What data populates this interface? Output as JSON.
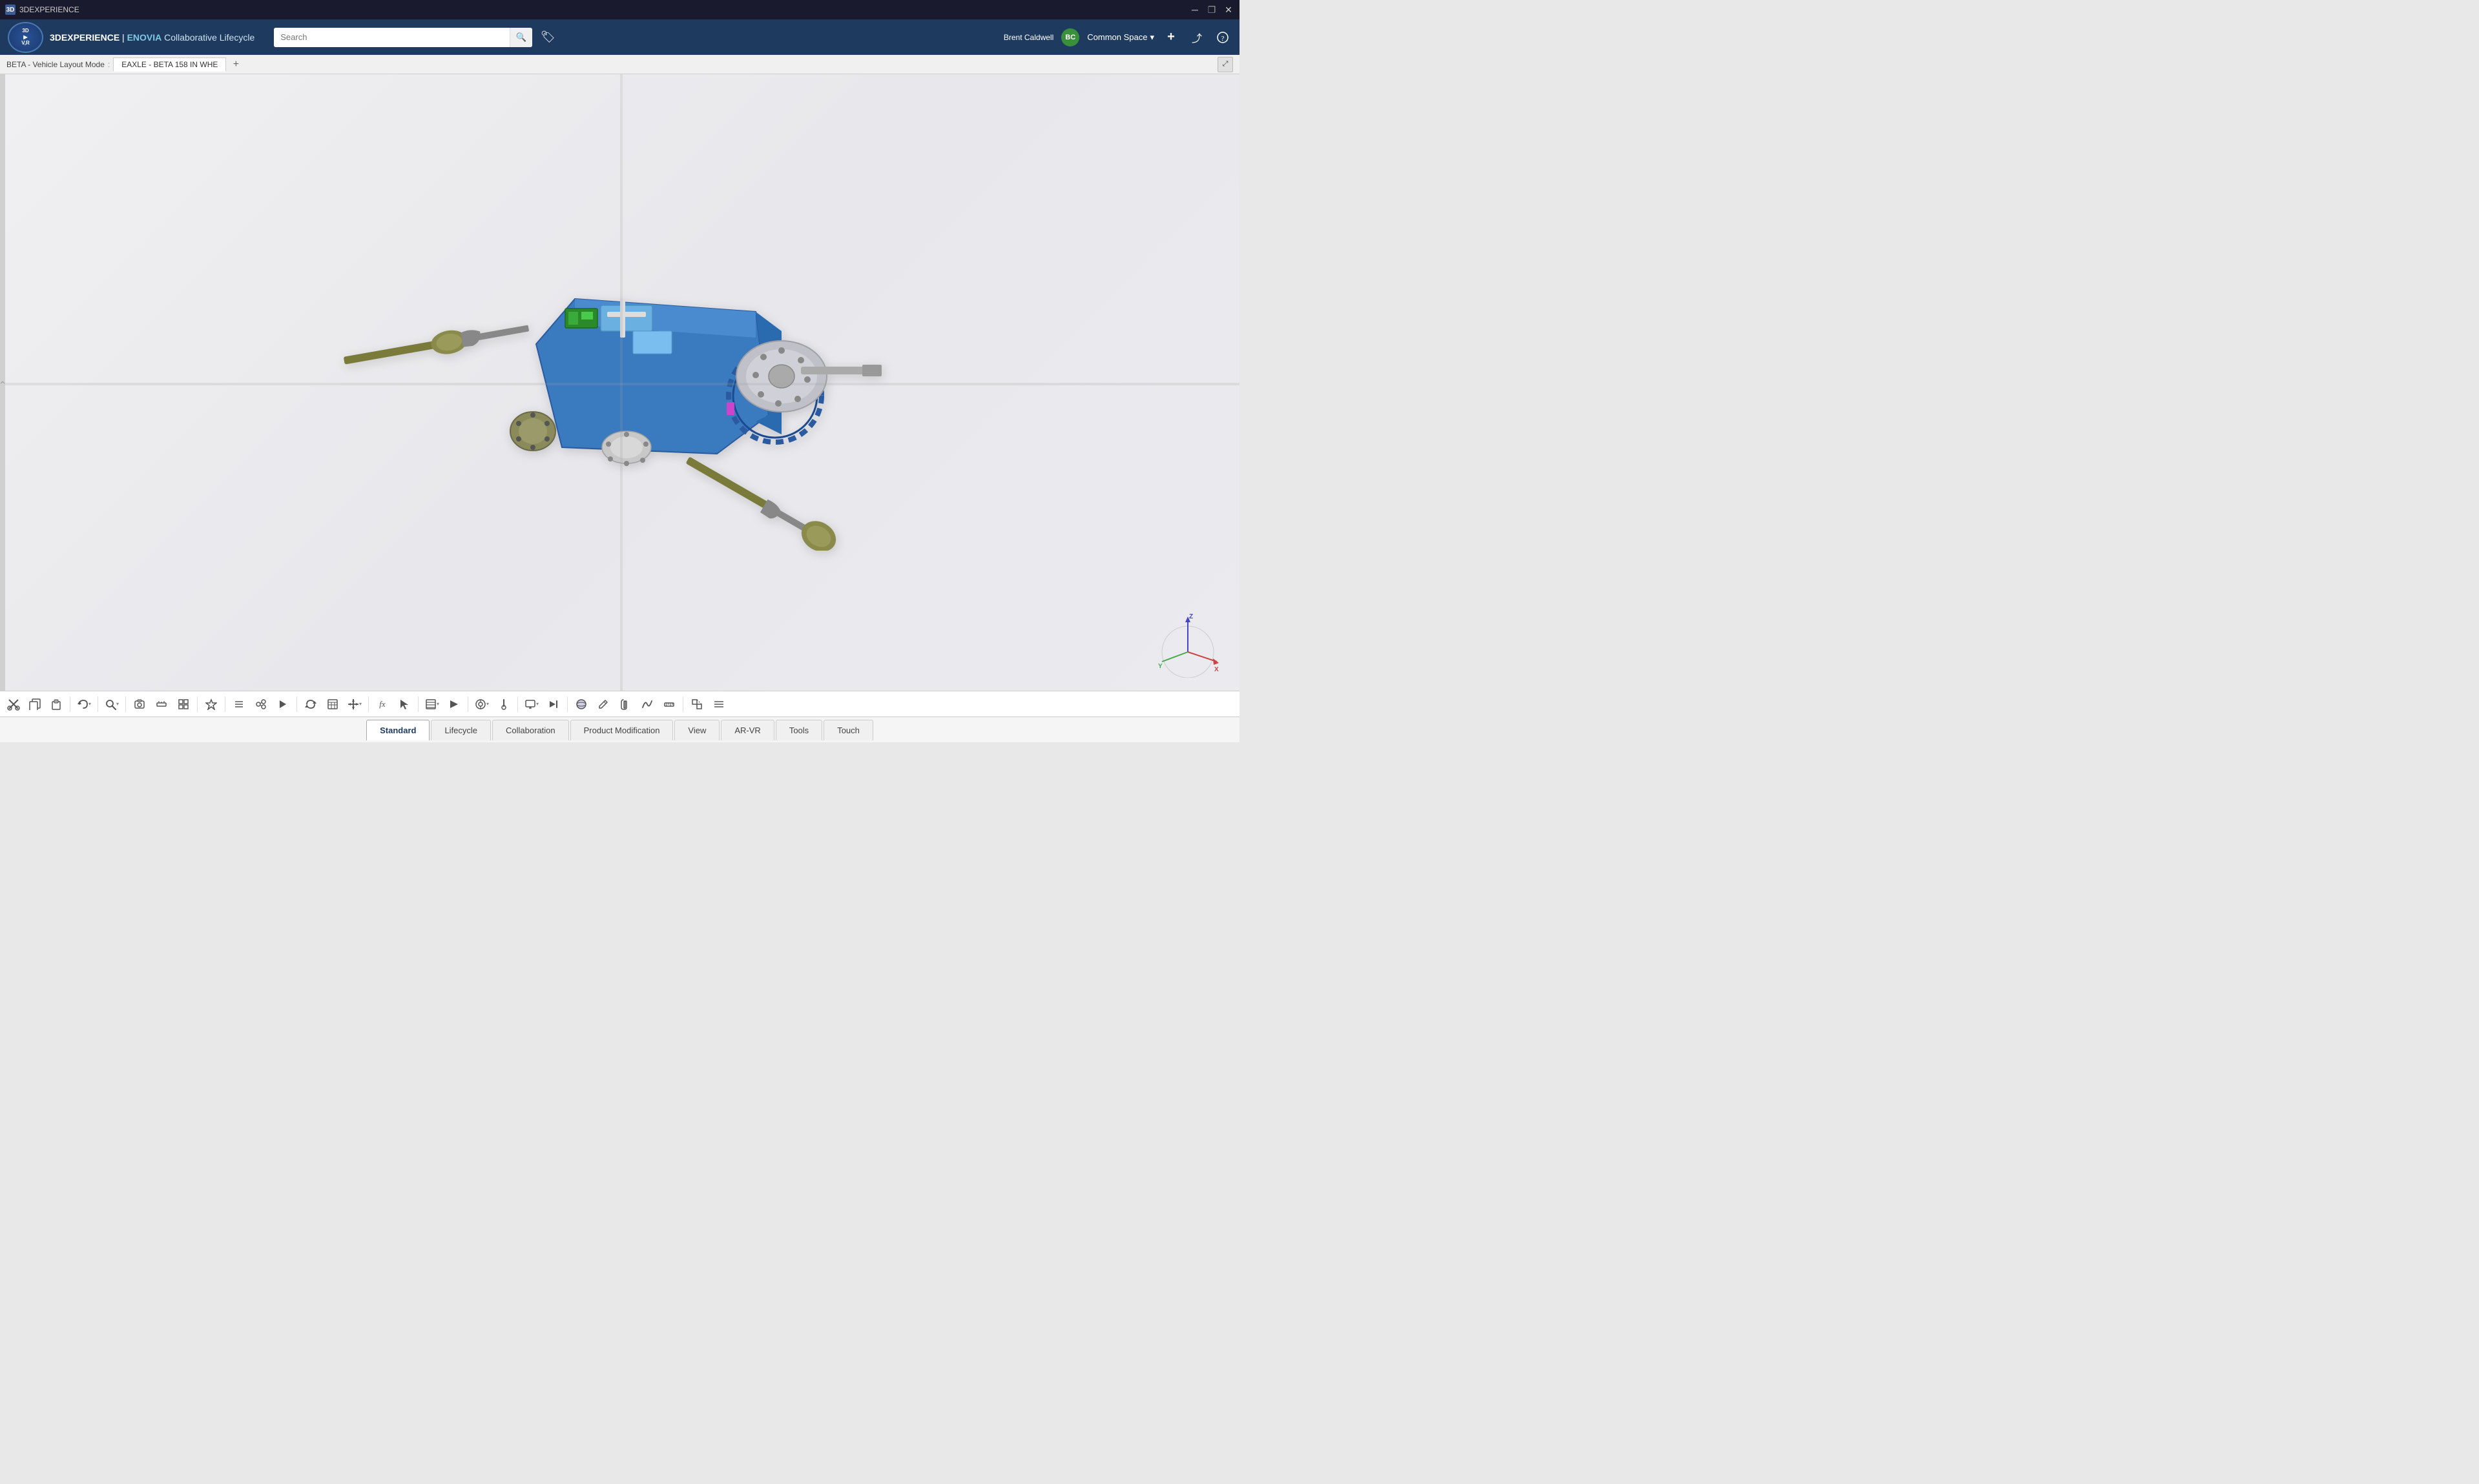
{
  "titleBar": {
    "appName": "3DEXPERIENCE",
    "closeBtn": "✕",
    "restoreBtn": "❐",
    "minimizeBtn": "─"
  },
  "navbar": {
    "logoLine1": "3D",
    "logoLine2": "▶",
    "logoLine3": "V,R",
    "brandPrefix": "3D",
    "brandName": "EXPERIENCE",
    "separator": " | ",
    "productName": "ENOVIA",
    "productSubtitle": " Collaborative Lifecycle",
    "searchPlaceholder": "Search",
    "searchIcon": "🔍",
    "tagIcon": "🏷",
    "userName": "Brent Caldwell",
    "userInitials": "BC",
    "commonSpace": "Common Space",
    "chevronIcon": "▾",
    "addIcon": "+",
    "shareIcon": "⤴",
    "helpIcon": "?"
  },
  "breadcrumb": {
    "item1": "BETA - Vehicle Layout Mode",
    "separator": ":",
    "tabLabel": "EAXLE - BETA 158 IN WHE",
    "addTabIcon": "+"
  },
  "viewport": {
    "background": "#e8e8ed"
  },
  "coordIndicator": {
    "xLabel": "X",
    "yLabel": "Y",
    "zLabel": "Z"
  },
  "toolbar": {
    "icons": [
      {
        "id": "cut",
        "symbol": "✂",
        "label": "Cut"
      },
      {
        "id": "copy",
        "symbol": "⧉",
        "label": "Copy"
      },
      {
        "id": "paste",
        "symbol": "📋",
        "label": "Paste"
      },
      {
        "id": "undo",
        "symbol": "↩",
        "label": "Undo"
      },
      {
        "id": "search-view",
        "symbol": "🔍",
        "label": "Search"
      },
      {
        "id": "capture",
        "symbol": "📷",
        "label": "Capture"
      },
      {
        "id": "measure",
        "symbol": "📐",
        "label": "Measure"
      },
      {
        "id": "grid",
        "symbol": "⊞",
        "label": "Grid"
      },
      {
        "id": "star",
        "symbol": "★",
        "label": "Favorites"
      },
      {
        "id": "list",
        "symbol": "☰",
        "label": "List"
      },
      {
        "id": "connect",
        "symbol": "⬡",
        "label": "Connect"
      },
      {
        "id": "sync",
        "symbol": "↻",
        "label": "Sync"
      },
      {
        "id": "table",
        "symbol": "⊞",
        "label": "Table"
      },
      {
        "id": "move",
        "symbol": "↕",
        "label": "Move"
      },
      {
        "id": "fx",
        "symbol": "fx",
        "label": "Function"
      },
      {
        "id": "select",
        "symbol": "↗",
        "label": "Select"
      },
      {
        "id": "table2",
        "symbol": "⊟",
        "label": "Table2"
      },
      {
        "id": "analysis",
        "symbol": "◈",
        "label": "Analysis"
      },
      {
        "id": "probe",
        "symbol": "⊕",
        "label": "Probe"
      },
      {
        "id": "display",
        "symbol": "🖥",
        "label": "Display"
      },
      {
        "id": "section",
        "symbol": "◧",
        "label": "Section"
      },
      {
        "id": "arrows",
        "symbol": "⇌",
        "label": "Navigation"
      },
      {
        "id": "sphere",
        "symbol": "⬤",
        "label": "Sphere"
      },
      {
        "id": "pen",
        "symbol": "✎",
        "label": "Pen"
      },
      {
        "id": "clip",
        "symbol": "📎",
        "label": "Clip"
      },
      {
        "id": "curve",
        "symbol": "〜",
        "label": "Curve"
      },
      {
        "id": "measure2",
        "symbol": "📏",
        "label": "Measure2"
      },
      {
        "id": "transform",
        "symbol": "⤡",
        "label": "Transform"
      },
      {
        "id": "more1",
        "symbol": "⋯",
        "label": "More"
      },
      {
        "id": "more2",
        "symbol": "⋯",
        "label": "More2"
      }
    ]
  },
  "bottomTabs": {
    "tabs": [
      {
        "id": "standard",
        "label": "Standard"
      },
      {
        "id": "lifecycle",
        "label": "Lifecycle"
      },
      {
        "id": "collaboration",
        "label": "Collaboration"
      },
      {
        "id": "product-modification",
        "label": "Product Modification"
      },
      {
        "id": "view",
        "label": "View"
      },
      {
        "id": "ar-vr",
        "label": "AR-VR"
      },
      {
        "id": "tools",
        "label": "Tools"
      },
      {
        "id": "touch",
        "label": "Touch"
      }
    ],
    "activeTab": "standard"
  },
  "model": {
    "description": "EAXLE electric axle 3D assembly model"
  }
}
